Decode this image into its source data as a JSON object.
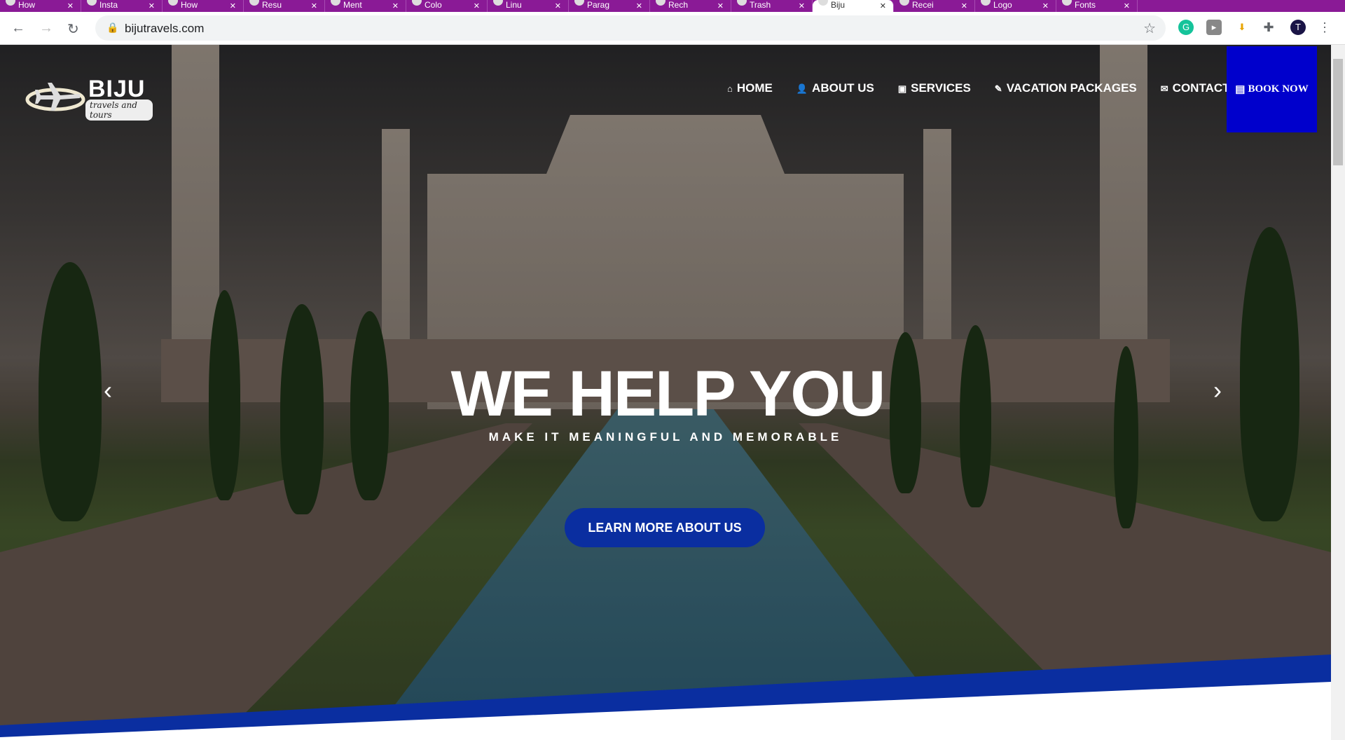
{
  "browser": {
    "tabs": [
      {
        "label": "How"
      },
      {
        "label": "Insta"
      },
      {
        "label": "How"
      },
      {
        "label": "Resu"
      },
      {
        "label": "Ment"
      },
      {
        "label": "Colo"
      },
      {
        "label": "Linu"
      },
      {
        "label": "Parag"
      },
      {
        "label": "Rech"
      },
      {
        "label": "Trash"
      },
      {
        "label": "Biju",
        "active": true
      },
      {
        "label": "Recei"
      },
      {
        "label": "Logo"
      },
      {
        "label": "Fonts"
      }
    ],
    "url": "bijutravels.com"
  },
  "site": {
    "logo": {
      "name": "BIJU",
      "tagline": "travels and tours"
    },
    "nav": [
      {
        "icon": "home-icon",
        "glyph": "⌂",
        "label": "HOME"
      },
      {
        "icon": "user-icon",
        "glyph": "👤",
        "label": "ABOUT US"
      },
      {
        "icon": "image-icon",
        "glyph": "▣",
        "label": "SERVICES"
      },
      {
        "icon": "edit-icon",
        "glyph": "✎",
        "label": "VACATION PACKAGES"
      },
      {
        "icon": "envelope-icon",
        "glyph": "✉",
        "label": "CONTACT"
      }
    ],
    "book_now": "BOOK NOW",
    "hero": {
      "title": "WE HELP YOU",
      "subtitle": "MAKE IT MEANINGFUL AND MEMORABLE",
      "cta": "LEARN MORE ABOUT US"
    },
    "colors": {
      "accent": "#0a2ea0",
      "book": "#0000cc",
      "tabbar": "#8a1a96"
    }
  }
}
